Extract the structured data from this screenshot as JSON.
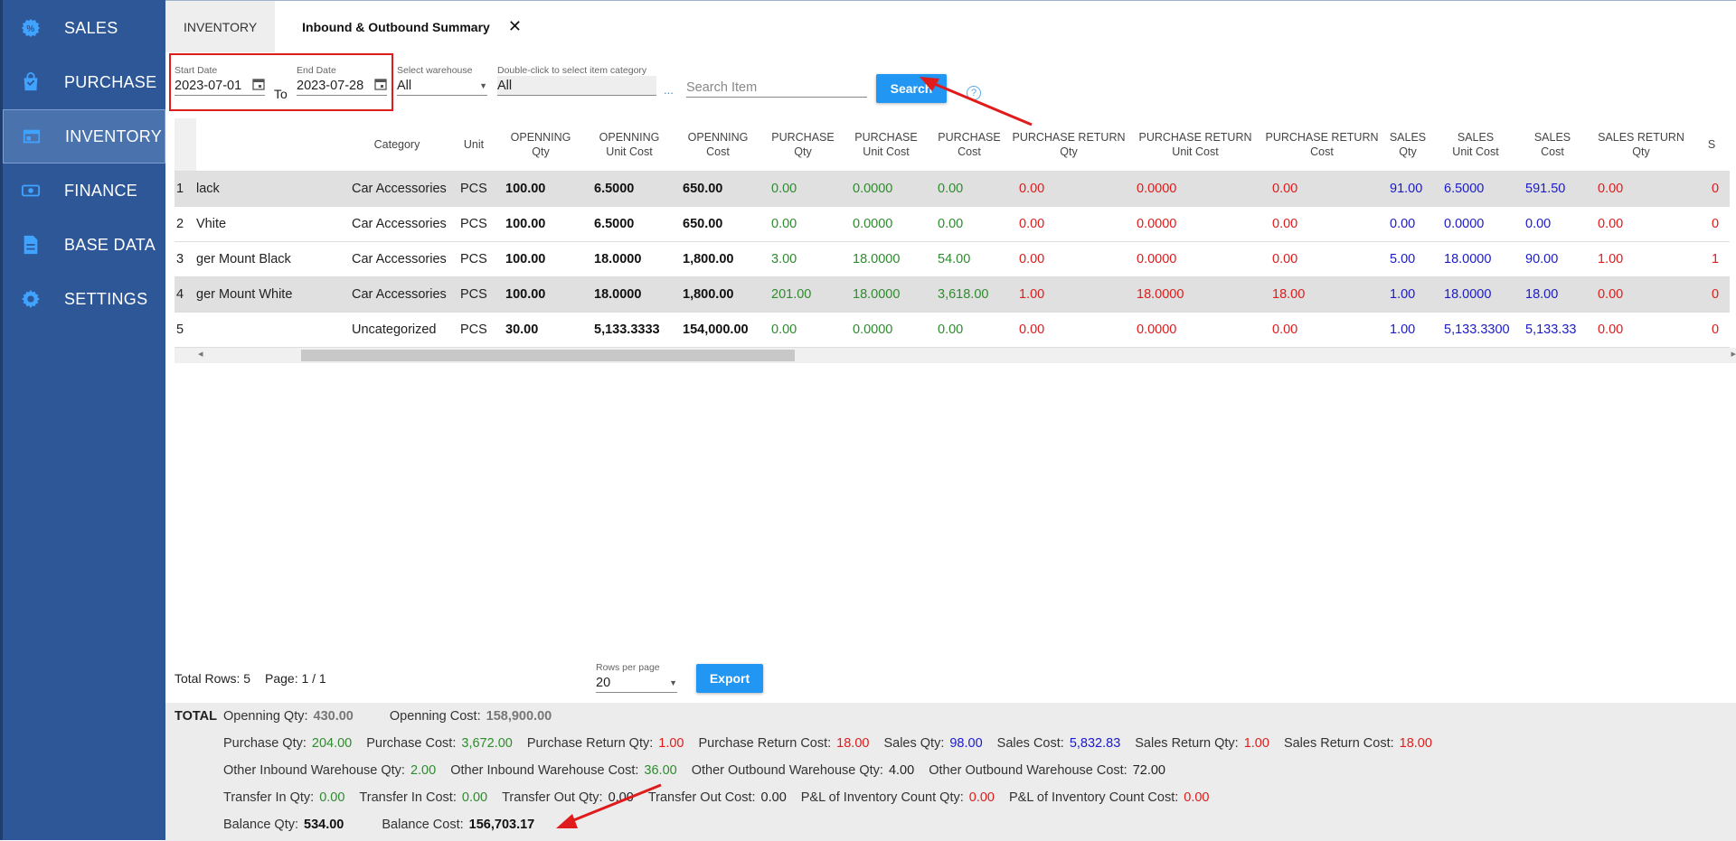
{
  "sidebar": {
    "items": [
      {
        "label": "SALES",
        "icon": "gear-badge-icon"
      },
      {
        "label": "PURCHASE",
        "icon": "shopping-bag-icon"
      },
      {
        "label": "INVENTORY",
        "icon": "warehouse-icon",
        "active": true
      },
      {
        "label": "FINANCE",
        "icon": "money-icon"
      },
      {
        "label": "BASE DATA",
        "icon": "document-icon"
      },
      {
        "label": "SETTINGS",
        "icon": "gear-icon"
      }
    ]
  },
  "tabs": {
    "inventory": "INVENTORY",
    "summary": "Inbound & Outbound Summary",
    "close": "✕"
  },
  "filters": {
    "start_label": "Start Date",
    "start_value": "2023-07-01",
    "to": "To",
    "end_label": "End Date",
    "end_value": "2023-07-28",
    "warehouse_label": "Select warehouse",
    "warehouse_value": "All",
    "category_label": "Double-click to select item category",
    "category_value": "All",
    "ellipsis": "...",
    "search_placeholder": "Search Item",
    "search_button": "Search",
    "help": "?"
  },
  "table": {
    "headers": [
      [
        "",
        ""
      ],
      [
        "Category",
        ""
      ],
      [
        "Unit",
        ""
      ],
      [
        "OPENNING",
        "Qty"
      ],
      [
        "OPENNING",
        "Unit Cost"
      ],
      [
        "OPENNING",
        "Cost"
      ],
      [
        "PURCHASE",
        "Qty"
      ],
      [
        "PURCHASE",
        "Unit Cost"
      ],
      [
        "PURCHASE",
        "Cost"
      ],
      [
        "PURCHASE RETURN",
        "Qty"
      ],
      [
        "PURCHASE RETURN",
        "Unit Cost"
      ],
      [
        "PURCHASE RETURN",
        "Cost"
      ],
      [
        "SALES",
        "Qty"
      ],
      [
        "SALES",
        "Unit Cost"
      ],
      [
        "SALES",
        "Cost"
      ],
      [
        "SALES RETURN",
        "Qty"
      ],
      [
        "S",
        ""
      ]
    ],
    "rows": [
      {
        "no": "1",
        "name": "lack",
        "category": "Car Accessories",
        "unit": "PCS",
        "cells": [
          "100.00",
          "6.5000",
          "650.00",
          "0.00",
          "0.0000",
          "0.00",
          "0.00",
          "0.0000",
          "0.00",
          "91.00",
          "6.5000",
          "591.50",
          "0.00",
          "0"
        ]
      },
      {
        "no": "2",
        "name": "Vhite",
        "category": "Car Accessories",
        "unit": "PCS",
        "cells": [
          "100.00",
          "6.5000",
          "650.00",
          "0.00",
          "0.0000",
          "0.00",
          "0.00",
          "0.0000",
          "0.00",
          "0.00",
          "0.0000",
          "0.00",
          "0.00",
          "0"
        ]
      },
      {
        "no": "3",
        "name": "ger Mount Black",
        "category": "Car Accessories",
        "unit": "PCS",
        "cells": [
          "100.00",
          "18.0000",
          "1,800.00",
          "3.00",
          "18.0000",
          "54.00",
          "0.00",
          "0.0000",
          "0.00",
          "5.00",
          "18.0000",
          "90.00",
          "1.00",
          "1"
        ]
      },
      {
        "no": "4",
        "name": "ger Mount White",
        "category": "Car Accessories",
        "unit": "PCS",
        "cells": [
          "100.00",
          "18.0000",
          "1,800.00",
          "201.00",
          "18.0000",
          "3,618.00",
          "1.00",
          "18.0000",
          "18.00",
          "1.00",
          "18.0000",
          "18.00",
          "0.00",
          "0"
        ]
      },
      {
        "no": "5",
        "name": "",
        "category": "Uncategorized",
        "unit": "PCS",
        "cells": [
          "30.00",
          "5,133.3333",
          "154,000.00",
          "0.00",
          "0.0000",
          "0.00",
          "0.00",
          "0.0000",
          "0.00",
          "1.00",
          "5,133.3300",
          "5,133.33",
          "0.00",
          "0"
        ]
      }
    ],
    "scroll_left": "◂",
    "scroll_right": "▸"
  },
  "pager": {
    "total_rows": "Total Rows: 5",
    "page": "Page: 1 / 1",
    "rows_per_page_label": "Rows per page",
    "rows_per_page_value": "20",
    "export": "Export"
  },
  "total": {
    "title": "TOTAL",
    "row1": [
      {
        "label": "Openning Qty:",
        "value": "430.00",
        "cls": "gray"
      },
      {
        "label": "Openning Cost:",
        "value": "158,900.00",
        "cls": "gray"
      }
    ],
    "row2": [
      {
        "label": "Purchase Qty:",
        "value": "204.00",
        "cls": "green"
      },
      {
        "label": "Purchase Cost:",
        "value": "3,672.00",
        "cls": "green"
      },
      {
        "label": "Purchase Return Qty:",
        "value": "1.00",
        "cls": "red"
      },
      {
        "label": "Purchase Return Cost:",
        "value": "18.00",
        "cls": "red"
      },
      {
        "label": "Sales Qty:",
        "value": "98.00",
        "cls": "blue"
      },
      {
        "label": "Sales Cost:",
        "value": "5,832.83",
        "cls": "blue"
      },
      {
        "label": "Sales Return Qty:",
        "value": "1.00",
        "cls": "red"
      },
      {
        "label": "Sales Return Cost:",
        "value": "18.00",
        "cls": "red"
      }
    ],
    "row3": [
      {
        "label": "Other Inbound Warehouse Qty:",
        "value": "2.00",
        "cls": "green"
      },
      {
        "label": "Other Inbound Warehouse Cost:",
        "value": "36.00",
        "cls": "green"
      },
      {
        "label": "Other Outbound Warehouse Qty:",
        "value": "4.00",
        "cls": "plain"
      },
      {
        "label": "Other Outbound Warehouse Cost:",
        "value": "72.00",
        "cls": "plain"
      }
    ],
    "row4": [
      {
        "label": "Transfer In Qty:",
        "value": "0.00",
        "cls": "green"
      },
      {
        "label": "Transfer In Cost:",
        "value": "0.00",
        "cls": "green"
      },
      {
        "label": "Transfer Out Qty:",
        "value": "0.00",
        "cls": "plain"
      },
      {
        "label": "Transfer Out Cost:",
        "value": "0.00",
        "cls": "plain"
      },
      {
        "label": "P&L of Inventory Count Qty:",
        "value": "0.00",
        "cls": "red"
      },
      {
        "label": "P&L of Inventory Count Cost:",
        "value": "0.00",
        "cls": "red"
      }
    ],
    "row5": [
      {
        "label": "Balance Qty:",
        "value": "534.00",
        "cls": "bold"
      },
      {
        "label": "Balance Cost:",
        "value": "156,703.17",
        "cls": "bold"
      }
    ]
  },
  "colors": {
    "sidebar": "#2e5797",
    "accent": "#2196f3",
    "green": "#2e8b2e",
    "red": "#e01b1b",
    "blue": "#1a1acc",
    "annotation": "#e01b1b"
  }
}
